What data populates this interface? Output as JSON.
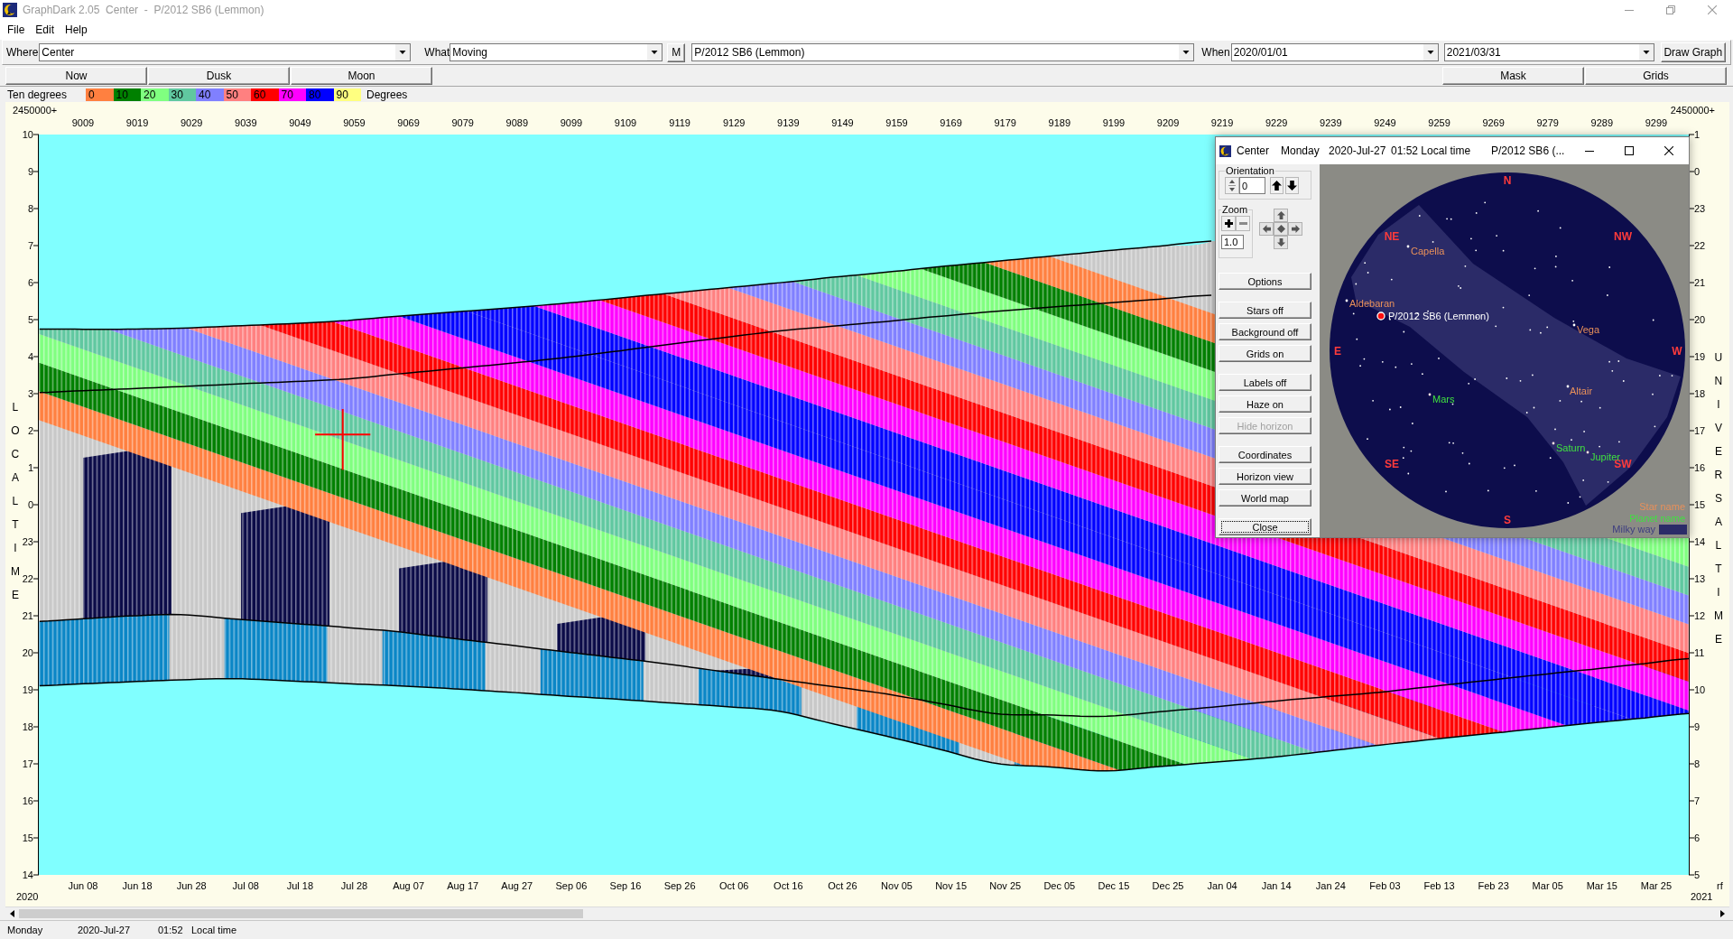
{
  "window": {
    "title": "GraphDark 2.05  Center  -  P/2012 SB6 (Lemmon)"
  },
  "menu": [
    "File",
    "Edit",
    "Help"
  ],
  "toolbar": {
    "where_label": "Where",
    "where_value": "Center",
    "what_label": "What",
    "what_value": "Moving",
    "m_button": "M",
    "object_value": "P/2012 SB6 (Lemmon)",
    "when_label": "When",
    "start_date": "2020/01/01",
    "end_date": "2021/03/31",
    "draw_button": "Draw Graph"
  },
  "view_buttons": [
    "Now",
    "Dusk",
    "Moon"
  ],
  "option_buttons": [
    "Mask",
    "Grids"
  ],
  "legend": {
    "title": "Ten degrees",
    "steps": [
      {
        "label": "0",
        "color": "#ff8040"
      },
      {
        "label": "10",
        "color": "#008000"
      },
      {
        "label": "20",
        "color": "#80ff80"
      },
      {
        "label": "30",
        "color": "#60c8a0"
      },
      {
        "label": "40",
        "color": "#8080ff"
      },
      {
        "label": "50",
        "color": "#ff8080"
      },
      {
        "label": "60",
        "color": "#ff0000"
      },
      {
        "label": "70",
        "color": "#ff00ff"
      },
      {
        "label": "80",
        "color": "#0000ff"
      },
      {
        "label": "90",
        "color": "#ffff80"
      }
    ],
    "unit": "Degrees"
  },
  "graph": {
    "jd_offset_left": "2450000+",
    "jd_offset_right": "2450000+",
    "local_ticks": [
      "10",
      "9",
      "8",
      "7",
      "6",
      "5",
      "4",
      "3",
      "2",
      "1",
      "0"
    ],
    "ut_axis_title": "UNIVERSAL TIME",
    "ut_ticks": [
      "1",
      "0",
      "23",
      "22",
      "21",
      "20",
      "19",
      "18",
      "17",
      "16",
      "15",
      "14",
      "13",
      "12",
      "11",
      "10",
      "9",
      "8",
      "7",
      "6",
      "5"
    ],
    "date_ticks": [
      "Jun 08",
      "Jun 18",
      "Jun 28",
      "Jul 08",
      "Jul 18",
      "Jul 28",
      "Aug 07",
      "Aug 17",
      "Aug 27",
      "Sep 06",
      "Sep 16",
      "Sep 26",
      "Oct 06",
      "Oct 16",
      "Oct 26",
      "Nov 05",
      "Nov 15",
      "Nov 25",
      "Dec 05",
      "Dec 15",
      "Dec 25",
      "Jan 04",
      "Jan 14",
      "Jan 24",
      "Feb 03",
      "Feb 13",
      "Feb 23",
      "Mar 05",
      "Mar 15",
      "Mar 25"
    ],
    "start_year": "2020",
    "end_year": "2021",
    "corner_label": "rf",
    "chart_data": {
      "type": "line",
      "ylabel": "LOCAL TIME",
      "x": [
        9001,
        9007,
        9017,
        9027,
        9037,
        9047,
        9057,
        9067,
        9077,
        9087,
        9097,
        9107,
        9117,
        9127,
        9137,
        9147,
        9157,
        9167,
        9177,
        9187,
        9197,
        9207,
        9217,
        9227,
        9237,
        9247,
        9257,
        9267,
        9277,
        9287,
        9297,
        9305
      ],
      "series": [
        {
          "color": "#000000",
          "values": [
            28.74,
            28.74,
            28.74,
            28.77,
            28.83,
            28.89,
            28.97,
            29.09,
            29.2,
            29.31,
            29.43,
            29.57,
            29.71,
            29.85,
            29.99,
            30.14,
            30.28,
            30.43,
            30.57,
            30.71,
            30.85,
            30.98,
            31.12,
            null,
            null,
            null,
            null,
            null,
            null,
            null,
            null,
            null
          ]
        },
        {
          "color": "#000000",
          "values": [
            27.03,
            27.07,
            27.13,
            27.19,
            27.26,
            27.32,
            27.39,
            27.53,
            27.67,
            27.81,
            27.96,
            28.14,
            28.33,
            28.51,
            28.69,
            28.82,
            28.95,
            29.09,
            29.22,
            29.33,
            29.44,
            29.55,
            29.66,
            null,
            null,
            null,
            null,
            null,
            null,
            null,
            null,
            null
          ]
        },
        {
          "color": "#000000",
          "values": [
            20.85,
            20.9,
            20.99,
            21.03,
            20.91,
            20.8,
            20.69,
            20.57,
            20.39,
            20.22,
            20.04,
            19.87,
            19.69,
            19.49,
            19.29,
            19.09,
            18.89,
            18.63,
            18.36,
            18.32,
            18.28,
            18.4,
            18.53,
            18.67,
            18.8,
            18.92,
            19.08,
            19.24,
            19.4,
            19.55,
            19.71,
            19.84
          ]
        },
        {
          "color": "#000000",
          "values": [
            19.11,
            19.15,
            19.21,
            19.27,
            19.3,
            19.24,
            19.17,
            19.11,
            19.03,
            18.94,
            18.84,
            18.75,
            18.65,
            18.55,
            18.43,
            18.09,
            17.75,
            17.39,
            17.02,
            16.92,
            16.81,
            16.92,
            17.04,
            17.16,
            17.32,
            17.49,
            17.65,
            17.8,
            17.95,
            18.1,
            18.24,
            18.36
          ]
        }
      ],
      "xlim": [
        9000.85,
        9305
      ],
      "ylim": [
        14,
        34
      ],
      "xticks": [
        9009,
        9019,
        9029,
        9039,
        9049,
        9059,
        9069,
        9079,
        9089,
        9099,
        9109,
        9119,
        9129,
        9139,
        9149,
        9159,
        9169,
        9179,
        9189,
        9199,
        9209,
        9219,
        9229,
        9239,
        9249,
        9259,
        9269,
        9279,
        9289,
        9299
      ],
      "yticks": [
        23,
        22,
        21,
        20,
        19,
        18,
        17,
        16,
        15,
        14
      ]
    }
  },
  "sky_window": {
    "title_parts": [
      "Center",
      "Monday",
      "2020-Jul-27",
      "01:52 Local time",
      "P/2012 SB6 (..."
    ],
    "orientation_label": "Orientation",
    "orientation_value": "0",
    "zoom_label": "Zoom",
    "zoom_value": "1.0",
    "button_groups": [
      [
        {
          "label": "Options",
          "disabled": false,
          "focused": false
        }
      ],
      [
        {
          "label": "Stars off",
          "disabled": false,
          "focused": false
        },
        {
          "label": "Background off",
          "disabled": false,
          "focused": false
        },
        {
          "label": "Grids on",
          "disabled": false,
          "focused": false
        }
      ],
      [
        {
          "label": "Labels off",
          "disabled": false,
          "focused": false
        },
        {
          "label": "Haze on",
          "disabled": false,
          "focused": false
        },
        {
          "label": "Hide horizon",
          "disabled": true,
          "focused": false
        }
      ],
      [
        {
          "label": "Coordinates",
          "disabled": false,
          "focused": false
        },
        {
          "label": "Horizon view",
          "disabled": false,
          "focused": false
        },
        {
          "label": "World map",
          "disabled": false,
          "focused": false
        }
      ],
      [
        {
          "label": "Close",
          "disabled": false,
          "focused": true
        }
      ]
    ],
    "directions": [
      "N",
      "NE",
      "NW",
      "E",
      "W",
      "SE",
      "SW",
      "S"
    ],
    "sky_objects": [
      {
        "kind": "star",
        "label": "Capella"
      },
      {
        "kind": "star",
        "label": "Aldebaran"
      },
      {
        "kind": "comet",
        "label": "P/2012 SB6 (Lemmon)"
      },
      {
        "kind": "star",
        "label": "Vega"
      },
      {
        "kind": "star",
        "label": "Altair"
      },
      {
        "kind": "planet",
        "label": "Mars"
      },
      {
        "kind": "planet",
        "label": "Saturn"
      },
      {
        "kind": "planet",
        "label": "Jupiter"
      }
    ],
    "key": [
      {
        "kind": "star",
        "label": "Star name"
      },
      {
        "kind": "planet",
        "label": "Planet name"
      },
      {
        "kind": "milky_way",
        "label": "Milky way"
      }
    ]
  },
  "status_bar": [
    "Monday",
    "2020-Jul-27",
    "01:52",
    "Local time"
  ]
}
